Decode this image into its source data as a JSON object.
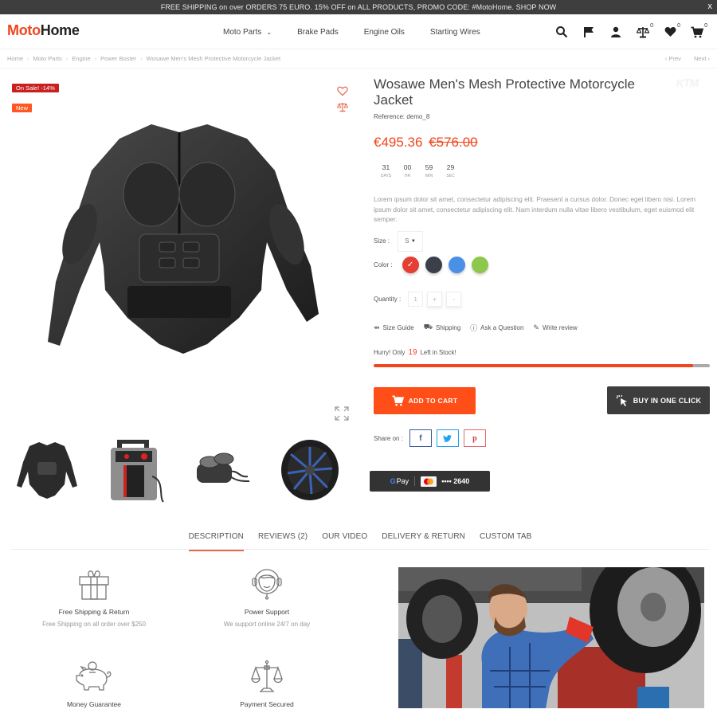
{
  "announcement": {
    "text": "FREE SHIPPING on over ORDERS 75 EURO. 15% OFF on ALL PRODUCTS, PROMO CODE: #MotoHome. SHOP NOW",
    "close_label": "x"
  },
  "header": {
    "logo_part1": "Moto",
    "logo_part2": "Home",
    "nav": [
      {
        "label": "Moto Parts",
        "has_dropdown": true
      },
      {
        "label": "Brake Pads"
      },
      {
        "label": "Engine Oils"
      },
      {
        "label": "Starting Wires"
      }
    ],
    "icons": [
      {
        "name": "search-icon"
      },
      {
        "name": "flag-icon"
      },
      {
        "name": "user-icon"
      },
      {
        "name": "compare-icon",
        "count": "0"
      },
      {
        "name": "wishlist-icon",
        "count": "0"
      },
      {
        "name": "cart-icon",
        "count": "0"
      }
    ]
  },
  "breadcrumb": {
    "items": [
      "Home",
      "Moto Parts",
      "Engine",
      "Power Boster",
      "Wosawe Men's Mesh Protective Motorcycle Jacket"
    ],
    "prev": "‹  Prev",
    "next": "Next  ›"
  },
  "gallery": {
    "badges": {
      "sale": "On Sale! -14%",
      "new": "New"
    },
    "thumbnails": [
      "motorcycle-jacket",
      "jump-starter",
      "brake-caliper",
      "alloy-wheel"
    ]
  },
  "product": {
    "brand_watermark": "KTM",
    "title": "Wosawe Men's Mesh Protective Motorcycle Jacket",
    "reference": "Reference: demo_8",
    "price": "€495.36",
    "old_price": "€576.00",
    "countdown": [
      {
        "value": "31",
        "label": "DAYS"
      },
      {
        "value": "00",
        "label": "HR"
      },
      {
        "value": "59",
        "label": "MIN"
      },
      {
        "value": "29",
        "label": "SEC"
      }
    ],
    "description": "Lorem ipsum dolor sit amet, consectetur adipiscing elit. Praesent a cursus dolor. Donec eget libero nisi. Lorem ipsum dolor sit amet, consectetur adipiscing elit. Nam interdum nulla vitae libero vestibulum, eget euismod elit semper.",
    "size_label": "Size :",
    "size_value": "S",
    "color_label": "Color :",
    "colors": [
      {
        "hex": "#e53f33",
        "selected": true
      },
      {
        "hex": "#3b3f4a",
        "selected": false
      },
      {
        "hex": "#4a90e6",
        "selected": false
      },
      {
        "hex": "#8cc84b",
        "selected": false
      }
    ],
    "quantity_label": "Quantity :",
    "quantity_value": "1",
    "qty_plus": "+",
    "qty_minus": "-",
    "links": [
      {
        "icon": "ruler-icon",
        "label": "Size Guide"
      },
      {
        "icon": "shipping-icon",
        "label": "Shipping"
      },
      {
        "icon": "question-icon",
        "label": "Ask a Question"
      },
      {
        "icon": "pencil-icon",
        "label": "Write review"
      }
    ],
    "stock_prefix": "Hurry! Only",
    "stock_count": "19",
    "stock_suffix": "Left in Stock!",
    "stock_progress": 0.95,
    "add_to_cart": "ADD TO CART",
    "buy_one_click": "BUY IN ONE CLICK",
    "share_label": "Share on :",
    "gpay_label": "Pay",
    "gpay_card": "•••• 2640"
  },
  "tabs": [
    {
      "label": "DESCRIPTION",
      "active": true
    },
    {
      "label": "REVIEWS (2)"
    },
    {
      "label": "OUR VIDEO"
    },
    {
      "label": "DELIVERY & RETURN"
    },
    {
      "label": "CUSTOM TAB"
    }
  ],
  "features": [
    {
      "icon": "gift-icon",
      "title": "Free Shipping & Return",
      "subtitle": "Free Shipping on all order over $250"
    },
    {
      "icon": "headset-icon",
      "title": "Power Support",
      "subtitle": "We support online 24/7 on day"
    },
    {
      "icon": "piggy-bank-icon",
      "title": "Money Guarantee",
      "subtitle": ""
    },
    {
      "icon": "scales-icon",
      "title": "Payment Secured",
      "subtitle": ""
    }
  ]
}
